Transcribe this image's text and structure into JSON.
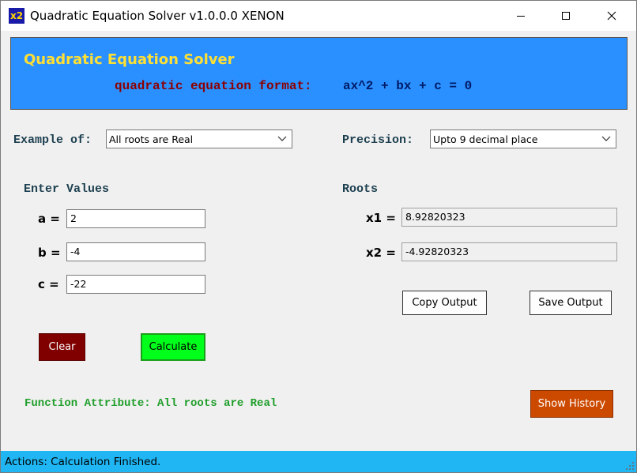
{
  "window": {
    "icon_text": "x2",
    "title": "Quadratic Equation Solver v1.0.0.0 XENON"
  },
  "banner": {
    "title": "Quadratic Equation Solver",
    "format_label": "quadratic equation format:",
    "format_equation": "ax^2 + bx + c = 0"
  },
  "example": {
    "label": "Example of:",
    "selected": "All roots are Real"
  },
  "precision": {
    "label": "Precision:",
    "selected": "Upto 9 decimal place"
  },
  "inputs": {
    "heading": "Enter Values",
    "a_label": "a =",
    "a_value": "2",
    "b_label": "b =",
    "b_value": "-4",
    "c_label": "c =",
    "c_value": "-22"
  },
  "roots": {
    "heading": "Roots",
    "x1_label": "x1 =",
    "x1_value": "8.92820323",
    "x2_label": "x2 =",
    "x2_value": "-4.92820323"
  },
  "buttons": {
    "copy_output": "Copy Output",
    "save_output": "Save Output",
    "clear": "Clear",
    "calculate": "Calculate",
    "show_history": "Show History"
  },
  "function_attribute": "Function Attribute: All roots are Real",
  "status": "Actions: Calculation Finished.",
  "colors": {
    "banner_bg": "#2b90ff",
    "banner_title": "#ffe033",
    "clear_bg": "#800000",
    "calculate_bg": "#00ff1a",
    "history_bg": "#cc4a00",
    "status_bg": "#1fb6f3",
    "attribute_text": "#1f9e2a"
  }
}
